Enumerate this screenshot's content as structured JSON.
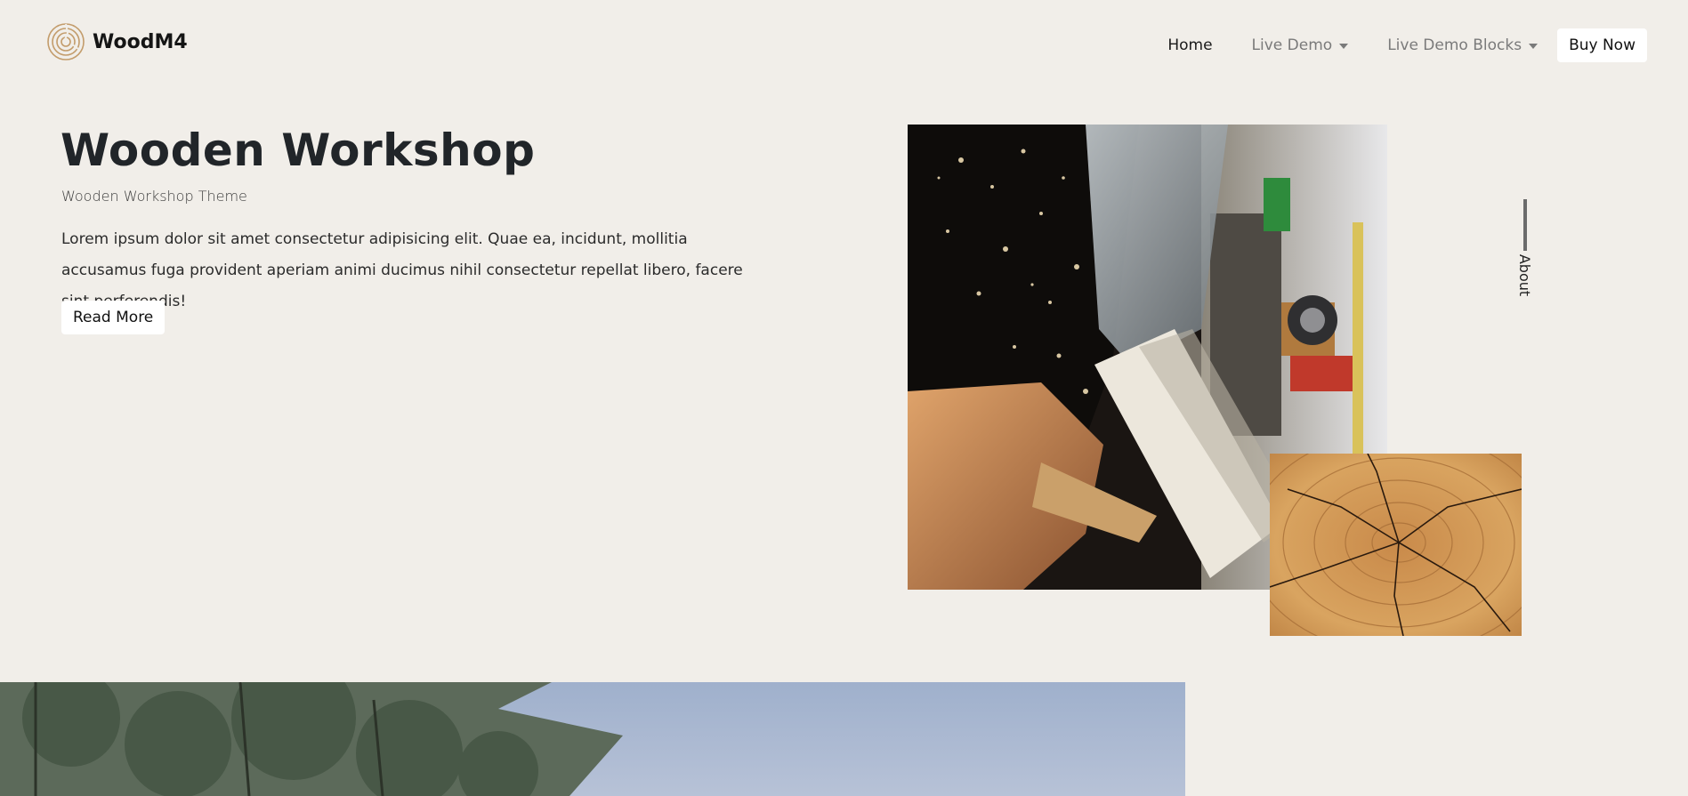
{
  "brand": {
    "name": "WoodM4",
    "logo_icon": "wood-rings-logo"
  },
  "nav": {
    "items": [
      {
        "label": "Home",
        "active": true
      },
      {
        "label": "Live Demo",
        "dropdown": true
      },
      {
        "label": "Live Demo Blocks",
        "dropdown": true
      }
    ],
    "cta_label": "Buy Now"
  },
  "hero": {
    "title": "Wooden Workshop",
    "subtitle": "Wooden Workshop Theme",
    "body": "Lorem ipsum dolor sit amet consectetur adipisicing elit. Quae ea, incidunt, mollitia accusamus fuga provident aperiam animi ducimus nihil consectetur repellat libero, facere sint perferendis!",
    "button_label": "Read More"
  },
  "side_nav": {
    "label": "About"
  },
  "colors": {
    "background": "#f1eee9",
    "logo_accent": "#c39c6b",
    "text_dark": "#212529"
  }
}
